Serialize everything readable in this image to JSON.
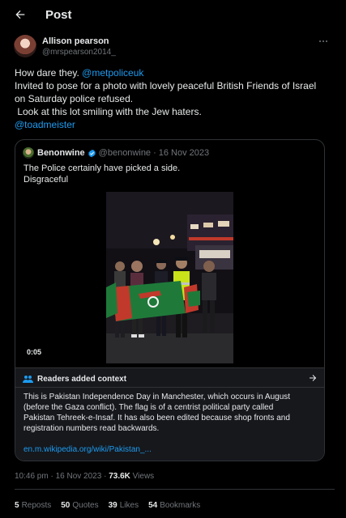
{
  "header": {
    "title": "Post",
    "back_icon": "arrow-left-icon"
  },
  "author": {
    "name": "Allison pearson",
    "handle": "@mrspearson2014_"
  },
  "post": {
    "line1_text": "How dare they. ",
    "line1_mention": "@metpoliceuk",
    "line2": "Invited to pose for a photo with lovely peaceful British Friends of Israel",
    "line3": "on Saturday police refused.",
    "line4": " Look at this lot smiling with the Jew haters.",
    "line5_mention": "@toadmeister"
  },
  "quote": {
    "name": "Benonwine",
    "handle": "@benonwine",
    "separator": "·",
    "date": "16 Nov 2023",
    "text_line1": "The Police certainly have picked a side.",
    "text_line2": "Disgraceful",
    "video_time": "0:05"
  },
  "context": {
    "title": "Readers added context",
    "line1": "This is Pakistan Independence Day in Manchester, which occurs in August",
    "line2": "(before the Gaza conflict). The flag is of a centrist political party called",
    "line3": "Pakistan Tehreek-e-Insaf. It has also been edited because shop fronts and",
    "line4": "registration numbers read backwards.",
    "link": "en.m.wikipedia.org/wiki/Pakistan_..."
  },
  "meta": {
    "time": "10:46 pm",
    "sep1": " · ",
    "date": "16 Nov 2023",
    "sep2": " · ",
    "views_count": "73.6K",
    "views_label": " Views"
  },
  "stats": {
    "reposts_count": "5",
    "reposts_label": "Reposts",
    "quotes_count": "50",
    "quotes_label": "Quotes",
    "likes_count": "39",
    "likes_label": "Likes",
    "bookmarks_count": "54",
    "bookmarks_label": "Bookmarks"
  },
  "colors": {
    "background": "#000000",
    "text": "#e7e9ea",
    "muted": "#71767b",
    "link": "#1d9bf0",
    "border": "#2f3336",
    "verified": "#1d9bf0"
  }
}
